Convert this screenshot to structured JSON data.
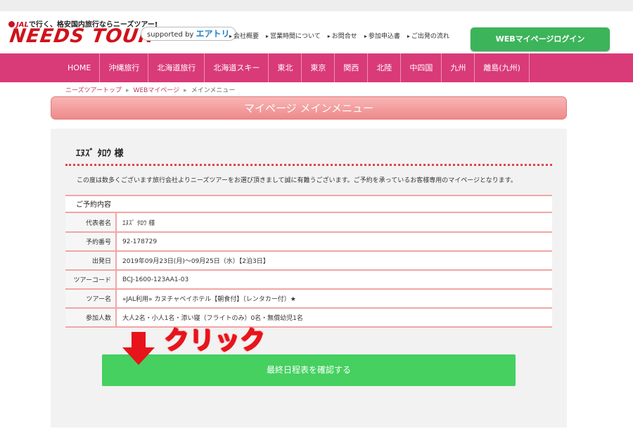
{
  "header": {
    "tagline_jal": "JAL",
    "tagline_text": "で行く、格安国内旅行ならニーズツアー!",
    "logo": "NEEDS TOUR",
    "supported_prefix": "supported by",
    "supported_brand": "エアトリ",
    "top_links": [
      "会社概要",
      "営業時間について",
      "お問合せ",
      "参加申込書",
      "ご出発の流れ"
    ],
    "login_button": "WEBマイページログイン"
  },
  "nav": {
    "items": [
      "HOME",
      "沖縄旅行",
      "北海道旅行",
      "北海道スキー",
      "東北",
      "東京",
      "関西",
      "北陸",
      "中四国",
      "九州",
      "離島(九州)"
    ]
  },
  "breadcrumb": {
    "items": [
      "ニーズツアートップ",
      "WEBマイページ",
      "メインメニュー"
    ]
  },
  "page_title": "マイページ メインメニュー",
  "customer_name": "ｴﾇｽﾞ ﾀﾛｳ 様",
  "greeting": "この度は数多くございます旅行会社よりニーズツアーをお選び頂きまして誠に有難うございます。ご予約を承っているお客様専用のマイページとなります。",
  "reservation": {
    "heading": "ご予約内容",
    "rows": [
      {
        "label": "代表者名",
        "value": "ｴﾇｽﾞ ﾀﾛｳ 様"
      },
      {
        "label": "予約番号",
        "value": "92-178729"
      },
      {
        "label": "出発日",
        "value": "2019年09月23日(月)〜09月25日（水）【2泊3日】"
      },
      {
        "label": "ツアーコード",
        "value": "BCJ-1600-123AA1-03"
      },
      {
        "label": "ツアー名",
        "value": "«JAL利用» カヌチャベイホテル【朝食付】（レンタカー付）★"
      },
      {
        "label": "参加人数",
        "value": "大人2名・小人1名・添い寝（フライトのみ）0名・無償幼児1名"
      }
    ]
  },
  "confirm_button": "最終日程表を確認する",
  "annotation": {
    "click_label": "クリック",
    "arrow": "arrow-down-icon"
  },
  "colors": {
    "nav_pink": "#d93a78",
    "login_green": "#3cb45a",
    "confirm_green": "#45d060",
    "logo_red": "#d0121b",
    "annotation_red": "#e8141b"
  }
}
